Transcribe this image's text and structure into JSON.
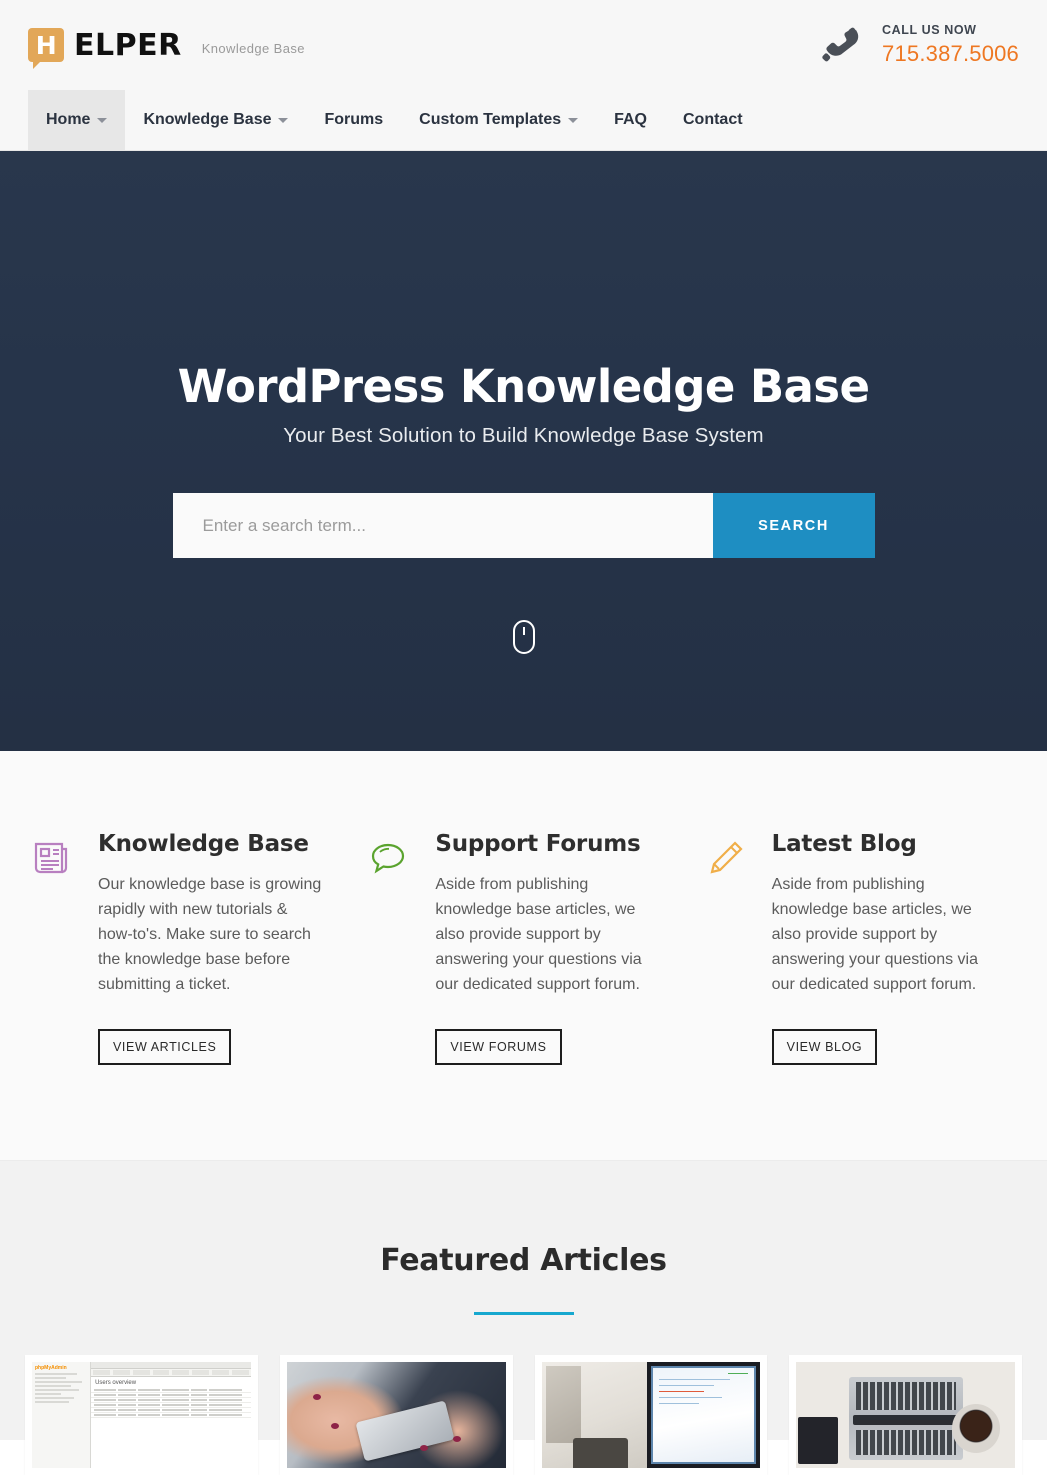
{
  "header": {
    "logo_letter": "H",
    "logo_word": "ELPER",
    "logo_tagline": "Knowledge Base",
    "phone_icon": "phone-handset-icon",
    "call_label": "CALL US NOW",
    "call_number": "715.387.5006"
  },
  "nav": {
    "items": [
      {
        "label": "Home",
        "has_dropdown": true,
        "active": true
      },
      {
        "label": "Knowledge Base",
        "has_dropdown": true,
        "active": false
      },
      {
        "label": "Forums",
        "has_dropdown": false,
        "active": false
      },
      {
        "label": "Custom Templates",
        "has_dropdown": true,
        "active": false
      },
      {
        "label": "FAQ",
        "has_dropdown": false,
        "active": false
      },
      {
        "label": "Contact",
        "has_dropdown": false,
        "active": false
      }
    ]
  },
  "hero": {
    "title": "WordPress Knowledge Base",
    "subtitle": "Your Best Solution to Build Knowledge Base System",
    "search_placeholder": "Enter a search term...",
    "search_value": "",
    "search_button": "SEARCH",
    "scroll_icon": "mouse-scroll-icon",
    "background_color": "#26344a"
  },
  "features": [
    {
      "icon": "newspaper-icon",
      "icon_color": "#b87fc0",
      "title": "Knowledge Base",
      "text": "Our knowledge base is growing rapidly with new tutorials & how-to's. Make sure to search the knowledge base before submitting a ticket.",
      "button": "VIEW ARTICLES"
    },
    {
      "icon": "speech-bubble-icon",
      "icon_color": "#5aa32e",
      "title": "Support Forums",
      "text": "Aside from publishing knowledge base articles, we also provide support by answering your questions via our dedicated support forum.",
      "button": "VIEW FORUMS"
    },
    {
      "icon": "pencil-icon",
      "icon_color": "#f0ae48",
      "title": "Latest Blog",
      "text": "Aside from publishing knowledge base articles, we also provide support by answering your questions via our dedicated support forum.",
      "button": "VIEW BLOG"
    }
  ],
  "featured": {
    "title": "Featured Articles",
    "accent_color": "#17a8cf",
    "cards": [
      {
        "thumbnail": "phpmyadmin-users-overview-screenshot"
      },
      {
        "thumbnail": "hands-holding-smartphone-photo"
      },
      {
        "thumbnail": "desk-with-monitor-photo"
      },
      {
        "thumbnail": "laptop-flatlay-photo"
      }
    ]
  }
}
